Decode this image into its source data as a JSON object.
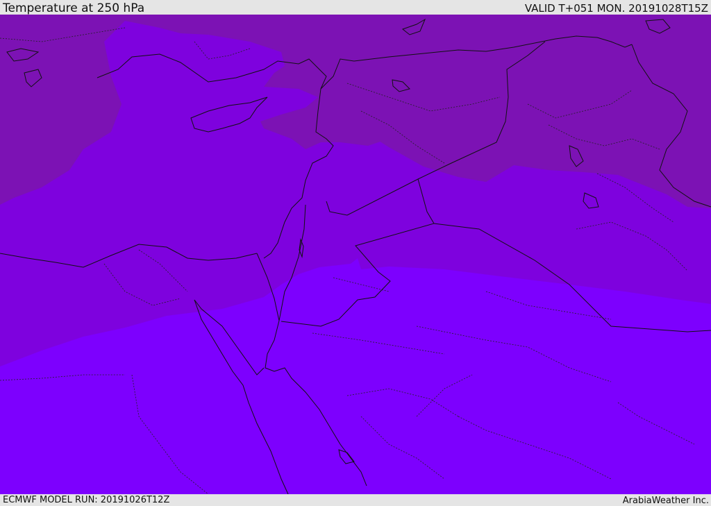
{
  "header": {
    "title": "Temperature at 250 hPa",
    "valid": "VALID T+051 MON. 20191028T15Z"
  },
  "footer": {
    "model_run": "ECMWF MODEL RUN: 20191026T12Z",
    "credit": "ArabiaWeather Inc."
  },
  "colors": {
    "band_cold": "#7c12b4",
    "band_mid": "#7e02de",
    "band_warm": "#7d00fe",
    "borders": "#111111"
  }
}
